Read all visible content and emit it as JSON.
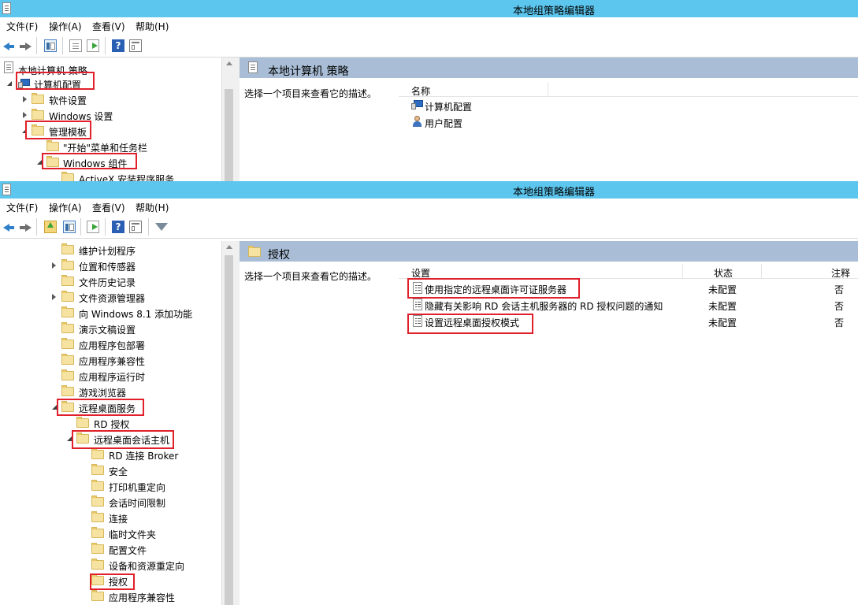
{
  "window1": {
    "title": "本地组策略编辑器",
    "menu": [
      "文件(F)",
      "操作(A)",
      "查看(V)",
      "帮助(H)"
    ],
    "tree": {
      "root": "本地计算机 策略",
      "computer_config": "计算机配置",
      "software_settings": "软件设置",
      "windows_settings": "Windows 设置",
      "admin_templates": "管理模板",
      "start_menu": "\"开始\"菜单和任务栏",
      "windows_components": "Windows 组件",
      "activex": "ActiveX 安装程序服务"
    },
    "right": {
      "header_title": "本地计算机 策略",
      "description": "选择一个项目来查看它的描述。",
      "column_name": "名称",
      "items": [
        "计算机配置",
        "用户配置"
      ]
    }
  },
  "window2": {
    "title": "本地组策略编辑器",
    "menu": [
      "文件(F)",
      "操作(A)",
      "查看(V)",
      "帮助(H)"
    ],
    "tree": [
      {
        "label": "维护计划程序",
        "expander": "none"
      },
      {
        "label": "位置和传感器",
        "expander": "collapsed"
      },
      {
        "label": "文件历史记录",
        "expander": "none"
      },
      {
        "label": "文件资源管理器",
        "expander": "collapsed"
      },
      {
        "label": "向 Windows 8.1 添加功能",
        "expander": "none"
      },
      {
        "label": "演示文稿设置",
        "expander": "none"
      },
      {
        "label": "应用程序包部署",
        "expander": "none"
      },
      {
        "label": "应用程序兼容性",
        "expander": "none"
      },
      {
        "label": "应用程序运行时",
        "expander": "none"
      },
      {
        "label": "游戏浏览器",
        "expander": "none"
      },
      {
        "label": "远程桌面服务",
        "expander": "expanded"
      },
      {
        "label": "RD 授权",
        "expander": "none"
      },
      {
        "label": "远程桌面会话主机",
        "expander": "expanded"
      },
      {
        "label": "RD 连接 Broker",
        "expander": "none"
      },
      {
        "label": "安全",
        "expander": "none"
      },
      {
        "label": "打印机重定向",
        "expander": "none"
      },
      {
        "label": "会话时间限制",
        "expander": "none"
      },
      {
        "label": "连接",
        "expander": "none"
      },
      {
        "label": "临时文件夹",
        "expander": "none"
      },
      {
        "label": "配置文件",
        "expander": "none"
      },
      {
        "label": "设备和资源重定向",
        "expander": "none"
      },
      {
        "label": "授权",
        "expander": "none"
      },
      {
        "label": "应用程序兼容性",
        "expander": "none"
      }
    ],
    "right": {
      "header_title": "授权",
      "description": "选择一个项目来查看它的描述。",
      "columns": {
        "setting": "设置",
        "state": "状态",
        "comment": "注释"
      },
      "rows": [
        {
          "setting": "使用指定的远程桌面许可证服务器",
          "state": "未配置",
          "comment": "否"
        },
        {
          "setting": "隐藏有关影响 RD 会话主机服务器的 RD 授权问题的通知",
          "state": "未配置",
          "comment": "否"
        },
        {
          "setting": "设置远程桌面授权模式",
          "state": "未配置",
          "comment": "否"
        }
      ]
    }
  },
  "colors": {
    "titlebar": "#5cc6ee",
    "header_band": "#a9bed6",
    "highlight_box": "#e0202a"
  }
}
